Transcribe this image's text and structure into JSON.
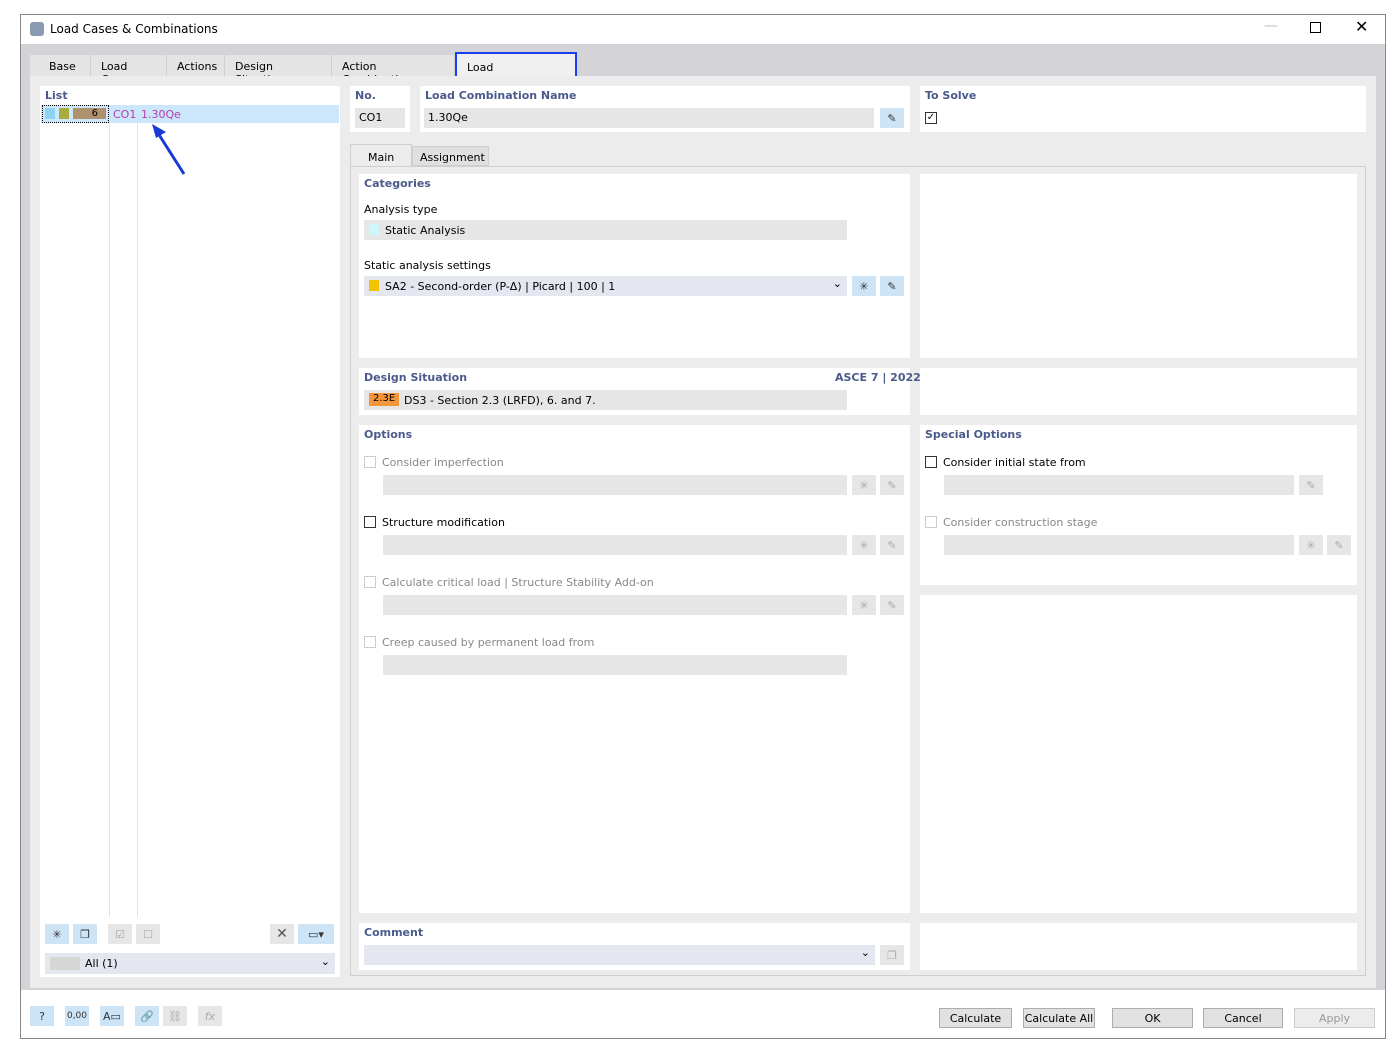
{
  "window": {
    "title": "Load Cases & Combinations"
  },
  "tabs": [
    "Base",
    "Load Cases",
    "Actions",
    "Design Situations",
    "Action Combinations",
    "Load Combinations"
  ],
  "list": {
    "label": "List",
    "items": [
      {
        "count": "6",
        "no": "CO1",
        "name": "1.30Qe",
        "colors": [
          "#8fd3f2",
          "#a8ac3c",
          "#b0916e"
        ]
      }
    ],
    "filter": "All (1)"
  },
  "header": {
    "no_label": "No.",
    "no_value": "CO1",
    "name_label": "Load Combination Name",
    "name_value": "1.30Qe",
    "solve_label": "To Solve",
    "solve_checked": true
  },
  "subtabs": [
    "Main",
    "Assignment"
  ],
  "categories": {
    "title": "Categories",
    "analysis_label": "Analysis type",
    "analysis_value": "Static Analysis",
    "analysis_color": "#ccf7fb",
    "settings_label": "Static analysis settings",
    "settings_value": "SA2 - Second-order (P-Δ) | Picard | 100 | 1",
    "settings_color": "#f5c400"
  },
  "design": {
    "title": "Design Situation",
    "standard": "ASCE 7 | 2022",
    "badge": "2.3E",
    "badge_color": "#f5963c",
    "value": "DS3 - Section 2.3 (LRFD), 6. and 7."
  },
  "options": {
    "title": "Options",
    "items": [
      "Consider imperfection",
      "Structure modification",
      "Calculate critical load | Structure Stability Add-on",
      "Creep caused by permanent load from"
    ]
  },
  "special": {
    "title": "Special Options",
    "items": [
      "Consider initial state from",
      "Consider construction stage"
    ]
  },
  "comment": {
    "title": "Comment"
  },
  "buttons": {
    "calculate": "Calculate",
    "calculate_all": "Calculate All",
    "ok": "OK",
    "cancel": "Cancel",
    "apply": "Apply"
  },
  "tool_values": {
    "decimal": "0,00"
  }
}
